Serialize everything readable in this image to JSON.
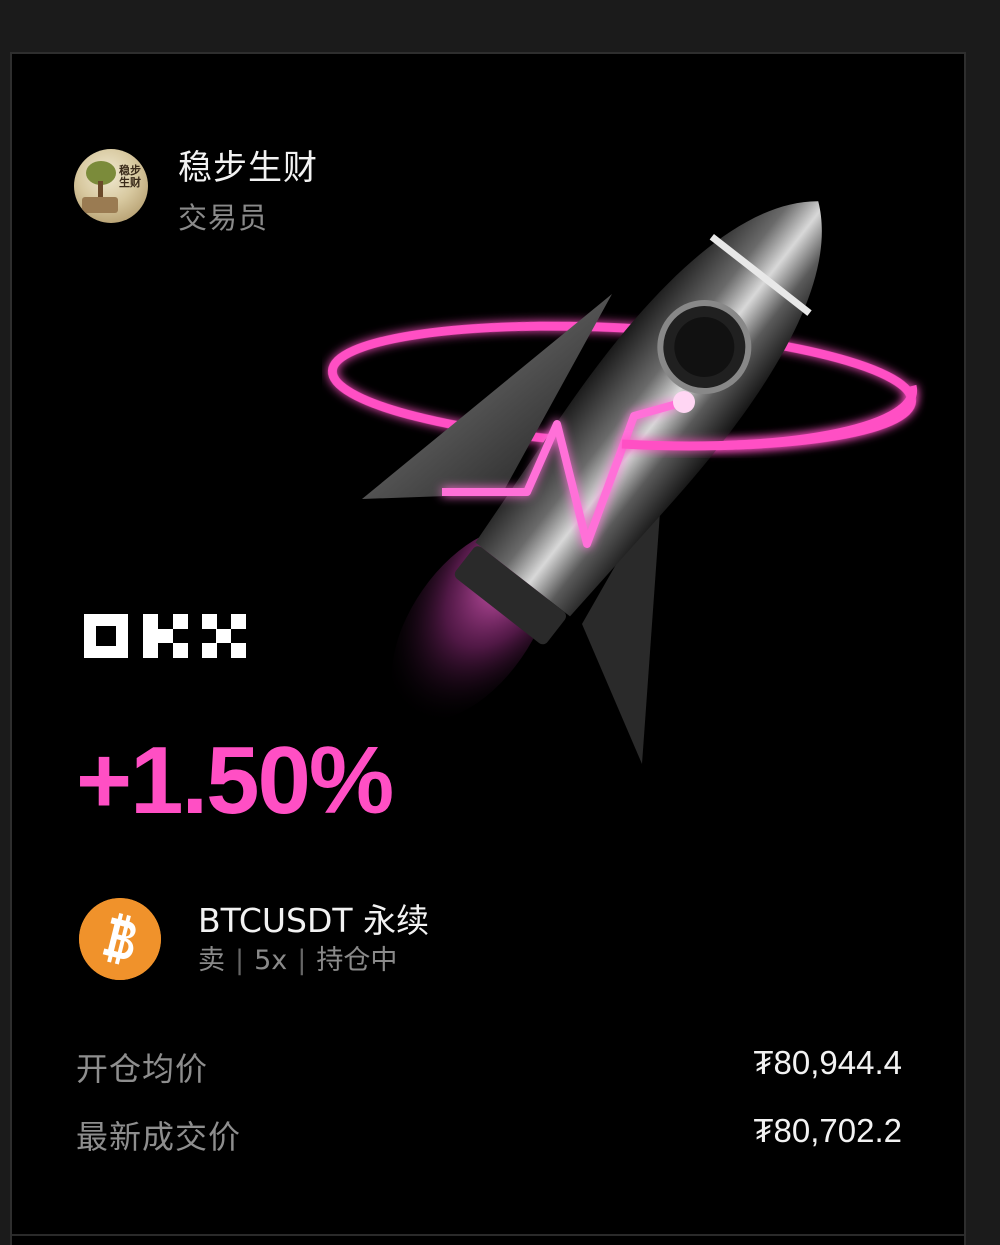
{
  "trader": {
    "name": "稳步生财",
    "role": "交易员",
    "avatar_text": "稳步生财"
  },
  "brand": {
    "logo": "OKX",
    "accent_color": "#ff4fc4"
  },
  "position": {
    "pnl_percent": "+1.50%",
    "coin_icon": "bitcoin-icon",
    "coin_color": "#f0922b",
    "pair": "BTCUSDT 永续",
    "side": "卖",
    "leverage": "5x",
    "status": "持仓中"
  },
  "stats": {
    "entry_label": "开仓均价",
    "entry_value": "₮80,944.4",
    "last_label": "最新成交价",
    "last_value": "₮80,702.2"
  }
}
